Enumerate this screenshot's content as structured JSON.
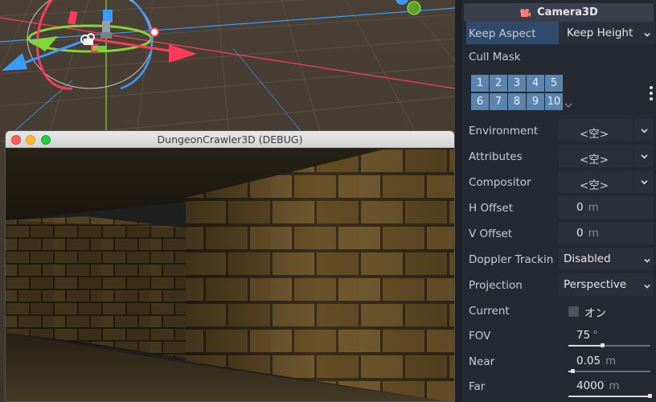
{
  "game_window": {
    "title": "DungeonCrawler3D (DEBUG)"
  },
  "inspector": {
    "header": {
      "title": "Camera3D",
      "icon": "camera-icon",
      "icon_color": "#fc7f7f"
    },
    "keep_aspect": {
      "label": "Keep Aspect",
      "value": "Keep Height"
    },
    "cull_mask": {
      "label": "Cull Mask",
      "layers": [
        "1",
        "2",
        "3",
        "4",
        "5",
        "6",
        "7",
        "8",
        "9",
        "10"
      ]
    },
    "environment": {
      "label": "Environment",
      "value": "<空>"
    },
    "attributes": {
      "label": "Attributes",
      "value": "<空>"
    },
    "compositor": {
      "label": "Compositor",
      "value": "<空>"
    },
    "h_offset": {
      "label": "H Offset",
      "value": "0",
      "unit": "m"
    },
    "v_offset": {
      "label": "V Offset",
      "value": "0",
      "unit": "m"
    },
    "doppler": {
      "label": "Doppler Trackin",
      "value": "Disabled"
    },
    "projection": {
      "label": "Projection",
      "value": "Perspective"
    },
    "current": {
      "label": "Current",
      "checkbox_label": "オン",
      "checked": false
    },
    "fov": {
      "label": "FOV",
      "value": "75",
      "unit": "°",
      "fraction": 0.42
    },
    "near": {
      "label": "Near",
      "value": "0.05",
      "unit": "m",
      "fraction": 0.06
    },
    "far": {
      "label": "Far",
      "value": "4000",
      "unit": "m",
      "fraction": 1.0
    }
  },
  "colors": {
    "accent_selected": "#2f4a6a",
    "cull_cell": "#5b85ae",
    "gizmo_x": "#ff3b5c",
    "gizmo_y": "#86d43b",
    "gizmo_z": "#3b9bff"
  }
}
